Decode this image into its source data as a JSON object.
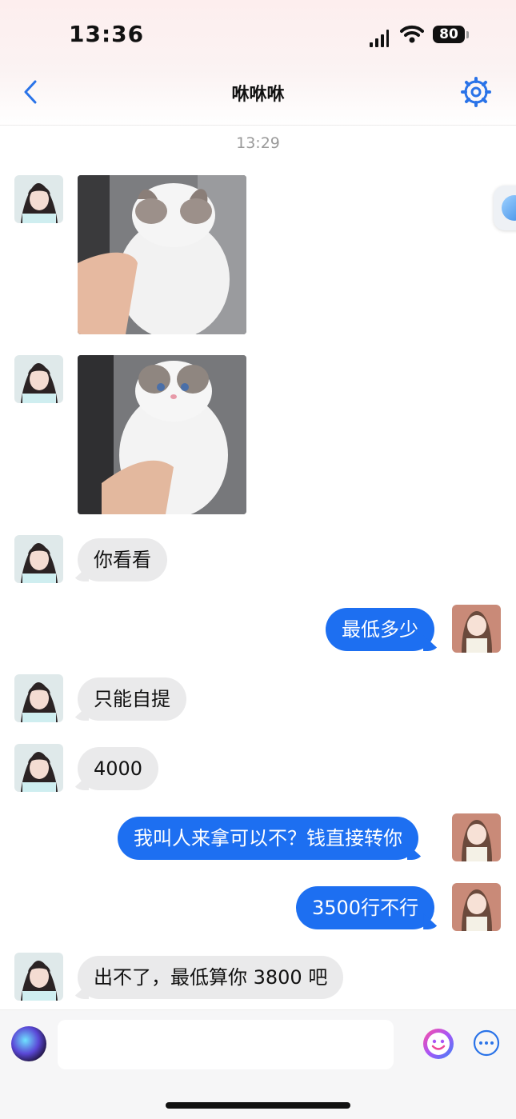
{
  "status_bar": {
    "time": "13:36",
    "battery": "80"
  },
  "nav": {
    "title": "咻咻咻",
    "back_icon": "chevron-left-icon",
    "settings_icon": "gear-icon"
  },
  "chat": {
    "timestamp": "13:29",
    "messages": [
      {
        "side": "in",
        "type": "image",
        "subject": "ragdoll cat photo"
      },
      {
        "side": "in",
        "type": "image",
        "subject": "ragdoll cat photo"
      },
      {
        "side": "in",
        "type": "text",
        "text": "你看看"
      },
      {
        "side": "out",
        "type": "text",
        "text": "最低多少"
      },
      {
        "side": "in",
        "type": "text",
        "text": "只能自提"
      },
      {
        "side": "in",
        "type": "text",
        "text": "4000"
      },
      {
        "side": "out",
        "type": "text",
        "text": "我叫人来拿可以不？钱直接转你"
      },
      {
        "side": "out",
        "type": "text",
        "text": "3500行不行"
      },
      {
        "side": "in",
        "type": "text",
        "text": "出不了，最低算你 3800 吧"
      }
    ]
  },
  "input_bar": {
    "placeholder": "",
    "emoji_icon": "emoji-icon",
    "more_icon": "more-icon"
  },
  "colors": {
    "accent": "#1d6ff1",
    "incoming_bubble": "#eaeaeb",
    "timestamp": "#9a9a9a"
  }
}
